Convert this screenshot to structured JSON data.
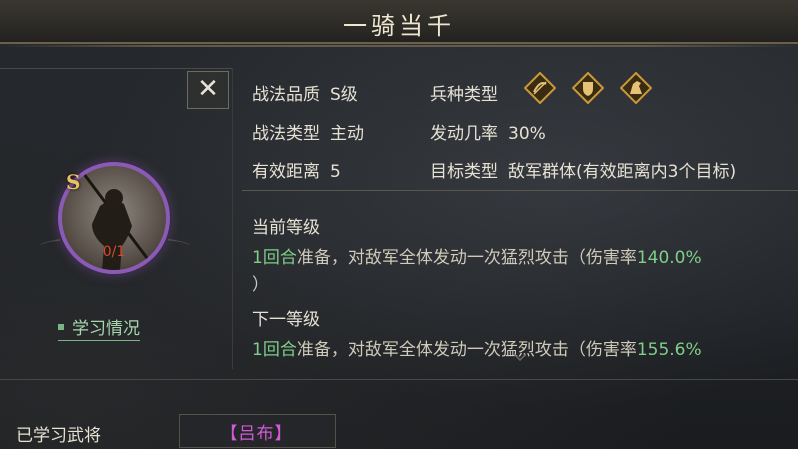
{
  "header": {
    "title": "一骑当千"
  },
  "skill": {
    "quality_label": "战法品质",
    "quality_value": "S级",
    "type_label": "战法类型",
    "type_value": "主动",
    "range_label": "有效距离",
    "range_value": "5",
    "troop_label": "兵种类型",
    "troop_icons": [
      "archer-icon",
      "shield-icon",
      "cavalry-icon"
    ],
    "rate_label": "发动几率",
    "rate_value": "30%",
    "target_label": "目标类型",
    "target_value": "敌军群体(有效距离内3个目标)"
  },
  "portrait": {
    "grade": "S",
    "progress": "0/1",
    "learn_link": "学习情况"
  },
  "levels": {
    "current_title": "当前等级",
    "current_prefix": "1回合",
    "current_text": "准备，对敌军全体发动一次猛烈攻击（伤害率",
    "current_rate": "140.0%",
    "current_tail": "）",
    "next_title": "下一等级",
    "next_prefix": "1回合",
    "next_text": "准备，对敌军全体发动一次猛烈攻击（伤害率",
    "next_rate": "155.6%"
  },
  "learned": {
    "label": "已学习武将",
    "general": "【吕布】"
  },
  "colors": {
    "accent_green": "#7fcf8a",
    "grade_gold": "#e7c45b",
    "purple_ring": "#8a5bb4",
    "general_magenta": "#d35ad8"
  }
}
